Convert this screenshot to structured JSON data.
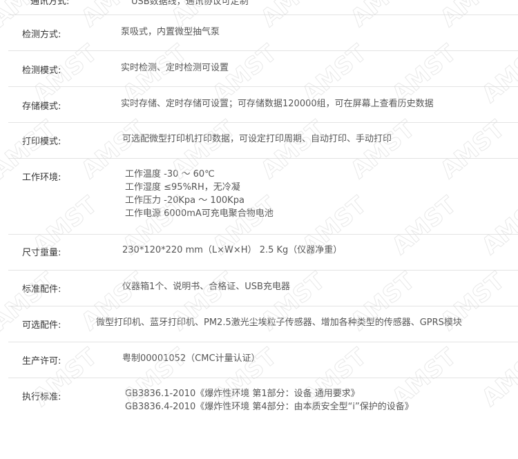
{
  "rows": [
    {
      "label": "检测方式:",
      "lines": [
        "泵吸式，内置微型抽气泵"
      ]
    },
    {
      "label": "检测模式:",
      "lines": [
        "实时检测、定时检测可设置"
      ]
    },
    {
      "label": "存储模式:",
      "lines": [
        "实时存储、定时存储可设置；可存储数据120000组，可在屏幕上查看历史数据"
      ]
    },
    {
      "label": "打印模式:",
      "lines": [
        "可选配微型打印机打印数据，可设定打印周期、自动打印、手动打印"
      ]
    },
    {
      "label": "工作环境:",
      "lines": [
        "工作温度 -30 ～ 60℃",
        "工作湿度 ≤95%RH，无冷凝",
        "工作压力 -20Kpa ～ 100Kpa",
        "工作电源 6000mA可充电聚合物电池"
      ]
    },
    {
      "label": "尺寸重量:",
      "lines": [
        "230*120*220 mm（L×W×H） 2.5 Kg（仪器净重）"
      ]
    },
    {
      "label": "标准配件:",
      "lines": [
        "仪器箱1个、说明书、合格证、USB充电器"
      ]
    },
    {
      "label": "可选配件:",
      "lines": [
        "微型打印机、蓝牙打印机、PM2.5激光尘埃粒子传感器、增加各种类型的传感器、GPRS模块"
      ]
    },
    {
      "label": "生产许可:",
      "lines": [
        "粤制00001052（CMC计量认证）"
      ]
    },
    {
      "label": "执行标准:",
      "lines": [
        "GB3836.1-2010《爆炸性环境 第1部分：设备 通用要求》",
        "GB3836.4-2010《爆炸性环境 第4部分：由本质安全型“i”保护的设备》"
      ]
    }
  ],
  "watermark": {
    "text": "AMST"
  }
}
